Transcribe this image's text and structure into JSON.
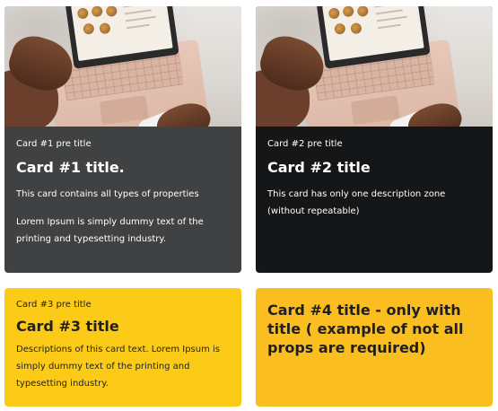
{
  "cards": [
    {
      "pretitle": "Card #1 pre title",
      "title": "Card #1 title.",
      "descriptions": [
        "This card contains all types of properties",
        "Lorem Ipsum is simply dummy text of the printing and typesetting industry."
      ],
      "background": "#3f4143"
    },
    {
      "pretitle": "Card #2 pre title",
      "title": "Card #2 title",
      "descriptions": [
        "This card has only one description zone (without repeatable)"
      ],
      "background": "#151618"
    },
    {
      "pretitle": "Card #3 pre title",
      "title": "Card #3 title",
      "descriptions": [
        "Descriptions of this card text. Lorem Ipsum is simply dummy text of the printing and typesetting industry."
      ],
      "background": "#fbcb17"
    },
    {
      "title": "Card #4 title - only with title ( example of not all props are required)",
      "background": "#fbbe20"
    }
  ]
}
